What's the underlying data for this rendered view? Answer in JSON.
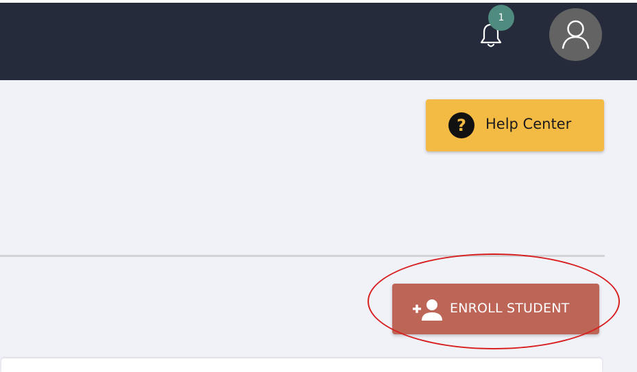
{
  "header": {
    "notifications": {
      "count": "1",
      "icon": "bell-icon"
    },
    "avatar": {
      "icon": "user-icon"
    }
  },
  "help": {
    "label": "Help Center",
    "icon": "question-circle-icon",
    "color": "#f4bb44"
  },
  "enroll": {
    "label": "ENROLL STUDENT",
    "icon": "add-user-icon",
    "color": "#bd6557"
  },
  "colors": {
    "navbar": "#252b3a",
    "background": "#f1f1f8",
    "annotation": "#d81f1f",
    "badge": "#4f8b7f"
  }
}
